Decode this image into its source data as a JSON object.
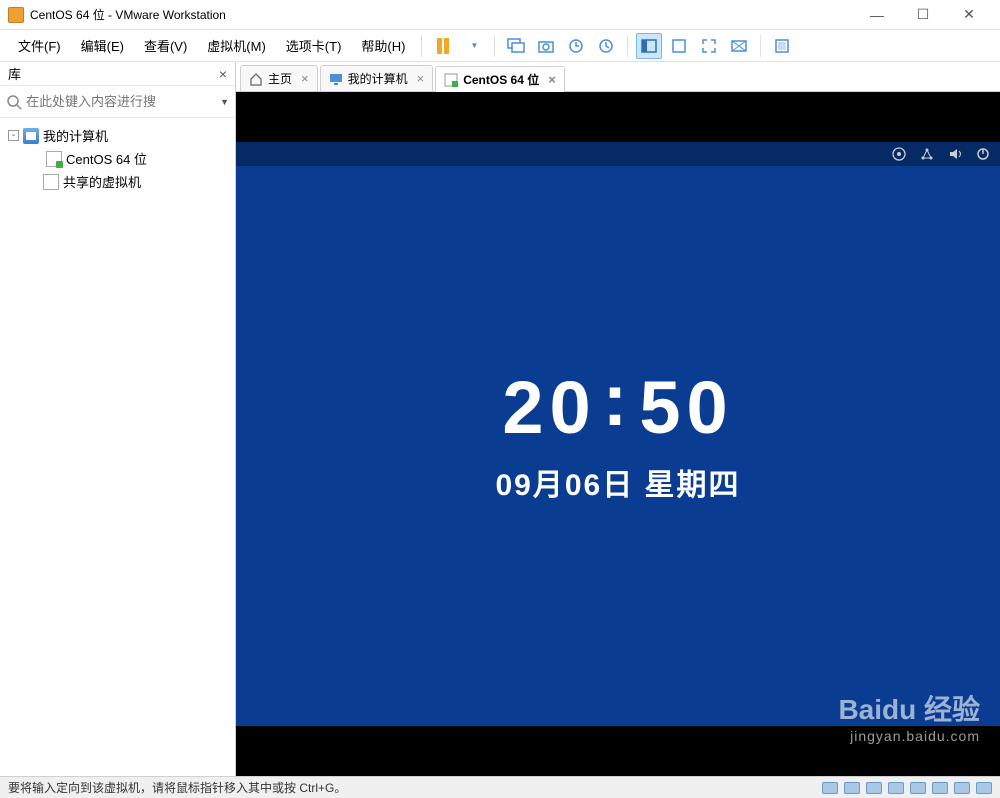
{
  "window": {
    "title": "CentOS 64 位 - VMware Workstation"
  },
  "menu": {
    "file": "文件(F)",
    "edit": "编辑(E)",
    "view": "查看(V)",
    "vm": "虚拟机(M)",
    "tabs": "选项卡(T)",
    "help": "帮助(H)"
  },
  "sidebar": {
    "title": "库",
    "search_placeholder": "在此处键入内容进行搜",
    "tree": {
      "my_computer": "我的计算机",
      "centos": "CentOS 64 位",
      "shared": "共享的虚拟机"
    }
  },
  "tabs": {
    "home": "主页",
    "my_computer": "我的计算机",
    "centos": "CentOS 64 位"
  },
  "guest": {
    "time_h": "20",
    "time_m": "50",
    "date": "09月06日  星期四"
  },
  "status": {
    "hint": "要将输入定向到该虚拟机，请将鼠标指针移入其中或按 Ctrl+G。"
  },
  "watermark": {
    "brand": "Baidu 经验",
    "url": "jingyan.baidu.com"
  }
}
